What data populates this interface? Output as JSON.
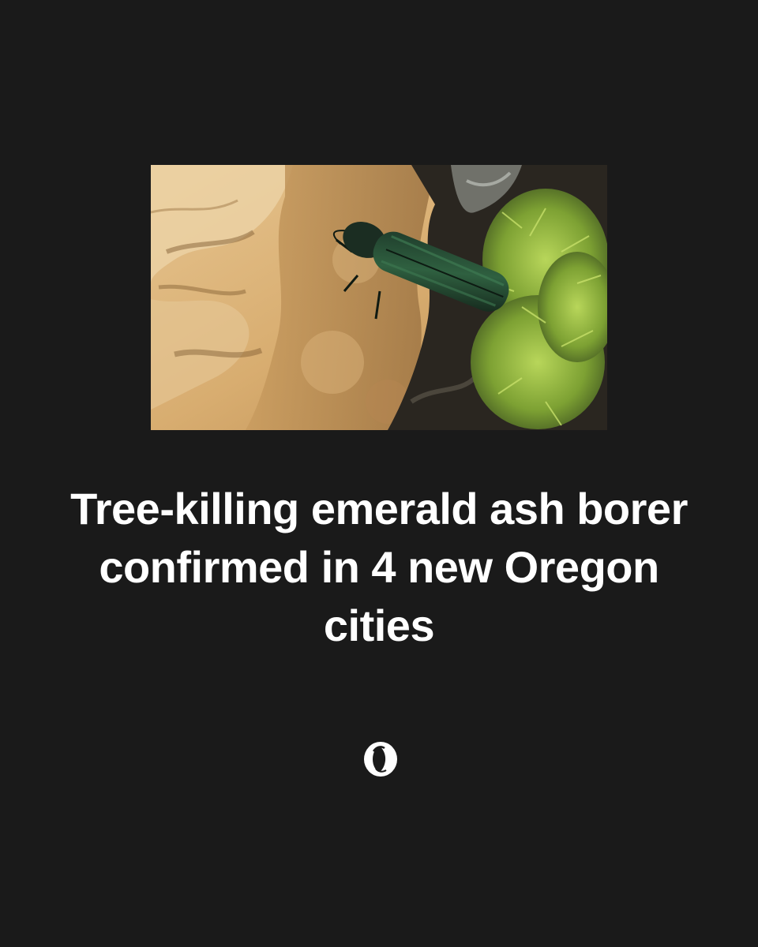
{
  "headline": "Tree-killing emerald ash borer confirmed in 4 new Oregon cities",
  "photo": {
    "subject": "emerald ash borer beetle on wood with moss"
  },
  "logo": {
    "icon": "oregonian-o-logo-icon"
  },
  "colors": {
    "background": "#1a1a1a",
    "text": "#ffffff"
  }
}
